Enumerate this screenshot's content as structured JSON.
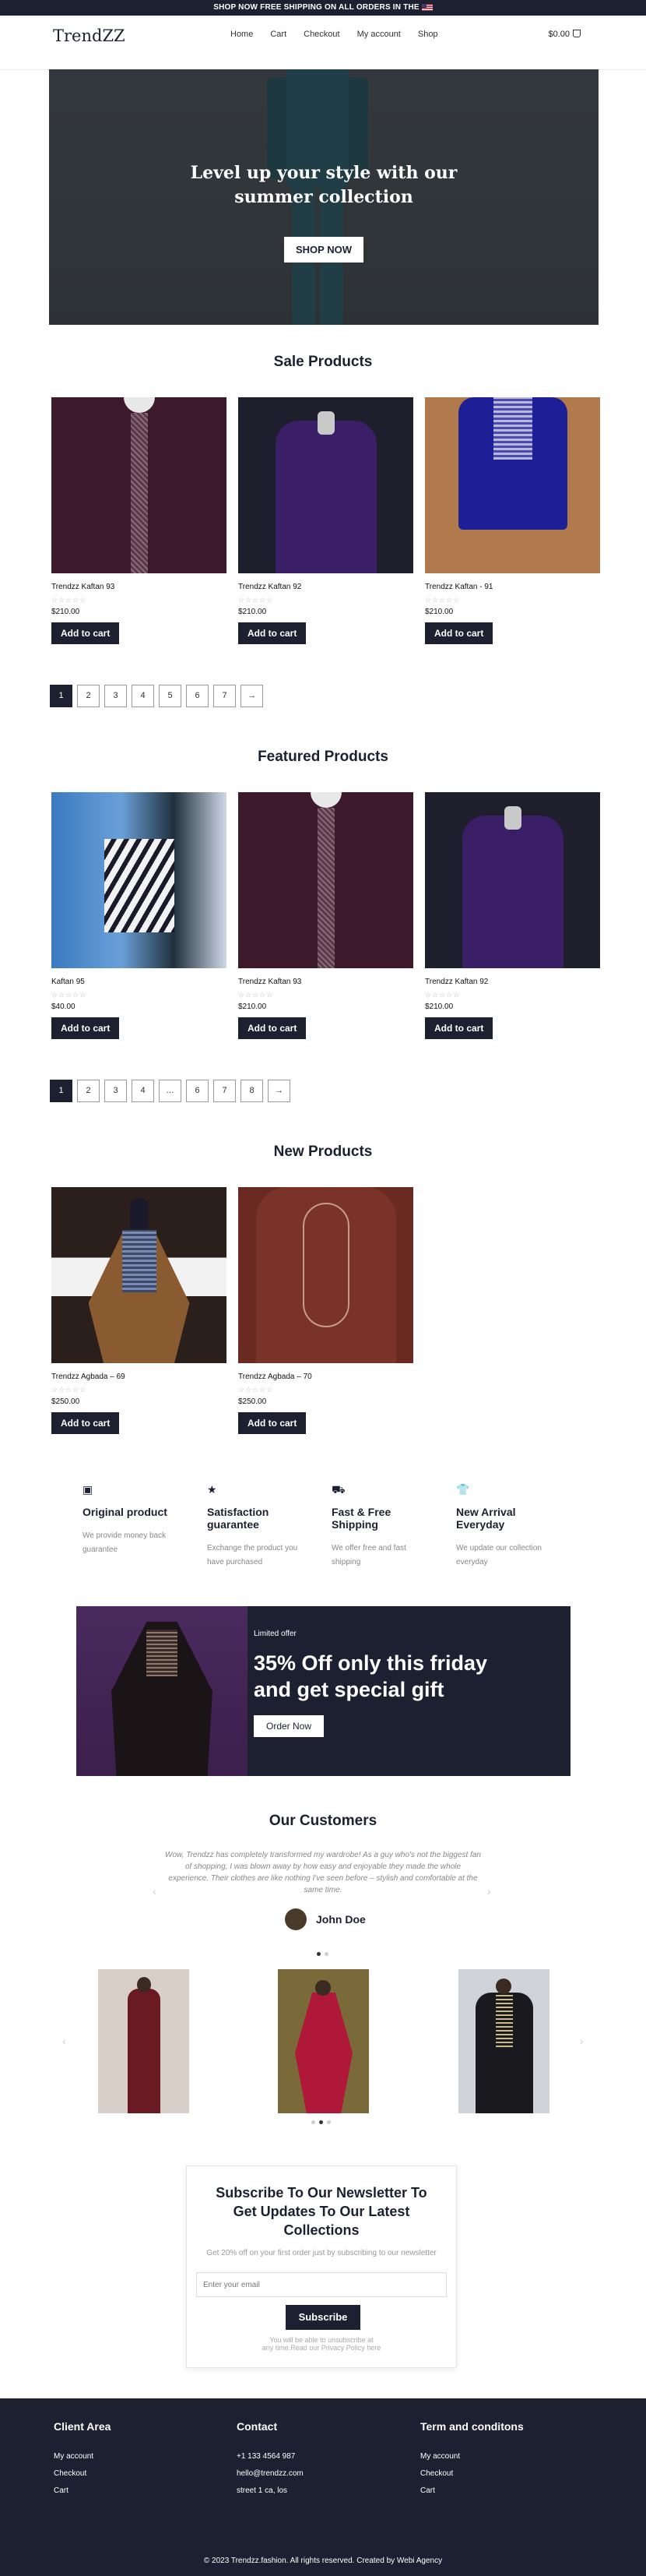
{
  "topbar": {
    "text": "SHOP NOW FREE SHIPPING ON ALL ORDERS IN THE"
  },
  "header": {
    "logo": "TrendZZ",
    "nav": [
      "Home",
      "Cart",
      "Checkout",
      "My account",
      "Shop"
    ],
    "cart_total": "$0.00",
    "cart_count": "0"
  },
  "hero": {
    "title_line1": "Level up your style with our",
    "title_line2": "summer collection",
    "button": "SHOP NOW"
  },
  "sale": {
    "title": "Sale Products",
    "products": [
      {
        "name": "Trendzz Kaftan 93",
        "price": "$210.00",
        "button": "Add to cart"
      },
      {
        "name": "Trendzz Kaftan 92",
        "price": "$210.00",
        "button": "Add to cart"
      },
      {
        "name": "Trendzz Kaftan - 91",
        "price": "$210.00",
        "button": "Add to cart"
      }
    ],
    "pages": [
      "1",
      "2",
      "3",
      "4",
      "5",
      "6",
      "7",
      "→"
    ]
  },
  "featured": {
    "title": "Featured Products",
    "products": [
      {
        "name": "Kaftan 95",
        "price": "$40.00",
        "button": "Add to cart"
      },
      {
        "name": "Trendzz Kaftan 93",
        "price": "$210.00",
        "button": "Add to cart"
      },
      {
        "name": "Trendzz Kaftan 92",
        "price": "$210.00",
        "button": "Add to cart"
      }
    ],
    "pages": [
      "1",
      "2",
      "3",
      "4",
      "…",
      "6",
      "7",
      "8",
      "→"
    ]
  },
  "new": {
    "title": "New Products",
    "products": [
      {
        "name": "Trendzz Agbada – 69",
        "price": "$250.00",
        "button": "Add to cart"
      },
      {
        "name": "Trendzz Agbada – 70",
        "price": "$250.00",
        "button": "Add to cart"
      }
    ]
  },
  "stars": "☆☆☆☆☆",
  "features": [
    {
      "icon": "box-icon",
      "title": "Original product",
      "text": "We provide money back guarantee"
    },
    {
      "icon": "star-icon",
      "title": "Satisfaction guarantee",
      "text": "Exchange the product you have purchased"
    },
    {
      "icon": "truck-icon",
      "title": "Fast & Free Shipping",
      "text": "We offer free and fast shipping"
    },
    {
      "icon": "tshirt-icon",
      "title": "New Arrival Everyday",
      "text": "We update our collection everyday"
    }
  ],
  "promo": {
    "label": "Limited offer",
    "title": "35% Off only this friday and get special gift",
    "button": "Order Now"
  },
  "customers": {
    "title": "Our Customers",
    "quote": "Wow, Trendzz has completely transformed my wardrobe! As a guy who's not the biggest fan of shopping, I was blown away by how easy and enjoyable they made the whole experience. Their clothes are like nothing I've seen before – stylish and comfortable at the same time.",
    "name": "John Doe"
  },
  "newsletter": {
    "title": "Subscribe To Our Newsletter To Get Updates To Our Latest Collections",
    "subtitle": "Get 20% off on your first order just by subscribing to our newsletter",
    "placeholder": "Enter your email",
    "button": "Subscribe",
    "fine1": "You will be able to unsubscribe at",
    "fine2": "any time.Read our Privacy Policy here"
  },
  "footer": {
    "col1": {
      "title": "Client Area",
      "links": [
        "My account",
        "Checkout",
        "Cart"
      ]
    },
    "col2": {
      "title": "Contact",
      "links": [
        "+1 133 4564 987",
        "hello@trendzz.com",
        "street 1 ca, los"
      ]
    },
    "col3": {
      "title": "Term and conditons",
      "links": [
        "My account",
        "Checkout",
        "Cart"
      ]
    },
    "copyright": "© 2023 Trendzz.fashion. All rights reserved. Created by Webi Agency"
  }
}
